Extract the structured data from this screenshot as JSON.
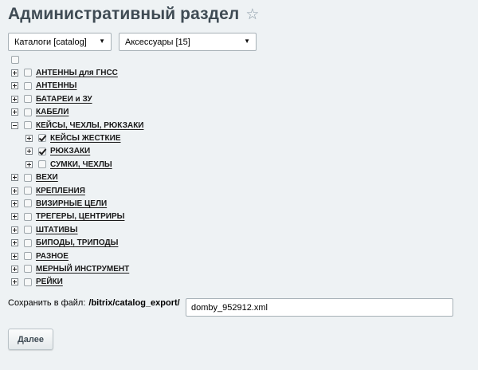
{
  "page": {
    "title": "Административный раздел",
    "star_icon": "star-icon"
  },
  "selects": {
    "catalog": "Каталоги [catalog]",
    "section": "Аксессуары [15]"
  },
  "tree": [
    {
      "label": "",
      "level": 0,
      "expander": "none",
      "checked": false
    },
    {
      "label": "АНТЕННЫ для ГНСС",
      "level": 0,
      "expander": "plus",
      "checked": false
    },
    {
      "label": "АНТЕННЫ",
      "level": 0,
      "expander": "plus",
      "checked": false
    },
    {
      "label": "БАТАРЕИ и ЗУ",
      "level": 0,
      "expander": "plus",
      "checked": false
    },
    {
      "label": "КАБЕЛИ",
      "level": 0,
      "expander": "plus",
      "checked": false
    },
    {
      "label": "КЕЙСЫ, ЧЕХЛЫ, РЮКЗАКИ",
      "level": 0,
      "expander": "minus",
      "checked": false
    },
    {
      "label": "КЕЙСЫ ЖЕСТКИЕ",
      "level": 1,
      "expander": "plus",
      "checked": true
    },
    {
      "label": "РЮКЗАКИ",
      "level": 1,
      "expander": "plus",
      "checked": true
    },
    {
      "label": "СУМКИ, ЧЕХЛЫ",
      "level": 1,
      "expander": "plus",
      "checked": false
    },
    {
      "label": "ВЕХИ",
      "level": 0,
      "expander": "plus",
      "checked": false
    },
    {
      "label": "КРЕПЛЕНИЯ",
      "level": 0,
      "expander": "plus",
      "checked": false
    },
    {
      "label": "ВИЗИРНЫЕ ЦЕЛИ",
      "level": 0,
      "expander": "plus",
      "checked": false
    },
    {
      "label": "ТРЕГЕРЫ, ЦЕНТРИРЫ",
      "level": 0,
      "expander": "plus",
      "checked": false
    },
    {
      "label": "ШТАТИВЫ",
      "level": 0,
      "expander": "plus",
      "checked": false
    },
    {
      "label": "БИПОДЫ, ТРИПОДЫ",
      "level": 0,
      "expander": "plus",
      "checked": false
    },
    {
      "label": "РАЗНОЕ",
      "level": 0,
      "expander": "plus",
      "checked": false
    },
    {
      "label": "МЕРНЫЙ ИНСТРУМЕНТ",
      "level": 0,
      "expander": "plus",
      "checked": false
    },
    {
      "label": "РЕЙКИ",
      "level": 0,
      "expander": "plus",
      "checked": false
    }
  ],
  "save": {
    "label": "Сохранить в файл:",
    "path": "/bitrix/catalog_export/",
    "filename": "domby_952912.xml"
  },
  "buttons": {
    "next": "Далее"
  }
}
